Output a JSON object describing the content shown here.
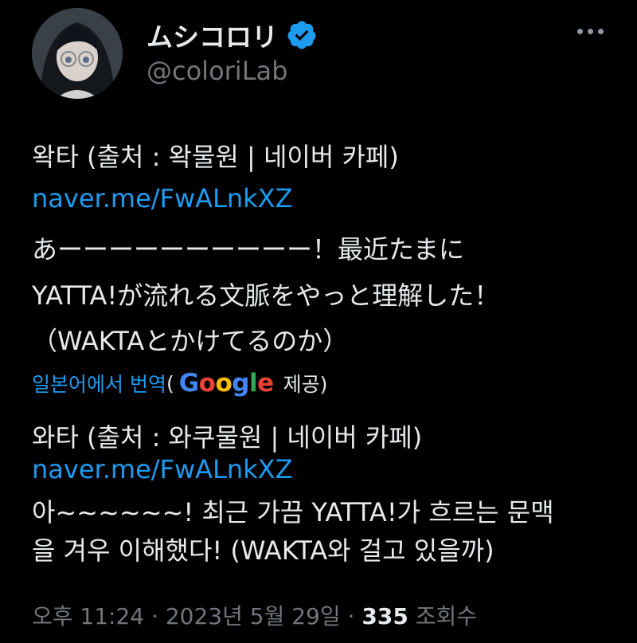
{
  "user": {
    "display_name": "ムシコロリ",
    "handle": "@coloriLab"
  },
  "tweet": {
    "lines": [
      "왁타 (출처 : 왁물원 | 네이버 카페)",
      "naver.me/FwALnkXZ",
      "あーーーーーーーーーー！最近たまに",
      "YATTA!が流れる文脈をやっと理解した！",
      "（WAKTAとかけてるのか）"
    ]
  },
  "translation": {
    "label": "일본어에서 번역",
    "provider_open": "(",
    "provider": "Google",
    "provider_suffix": "제공)",
    "lines": [
      "와타 (출처 : 와쿠물원 | 네이버 카페)",
      "naver.me/FwALnkXZ",
      "아~~~~~~! 최근 가끔 YATTA!가 흐르는 문맥",
      "을 겨우 이해했다! (WAKTA와 걸고 있을까)"
    ]
  },
  "meta": {
    "time": "오후 11:24",
    "sep1": "·",
    "date": "2023년 5월 29일",
    "sep2": "·",
    "views_count": "335",
    "views_label": "조회수"
  },
  "colors": {
    "background": "#000000",
    "text": "#e7e9ea",
    "link": "#1d9bf0",
    "muted": "#71767b",
    "verified": "#1d9bf0"
  },
  "icons": {
    "verified": "verified-badge-icon",
    "more": "more-options-icon",
    "avatar": "avatar-image"
  }
}
